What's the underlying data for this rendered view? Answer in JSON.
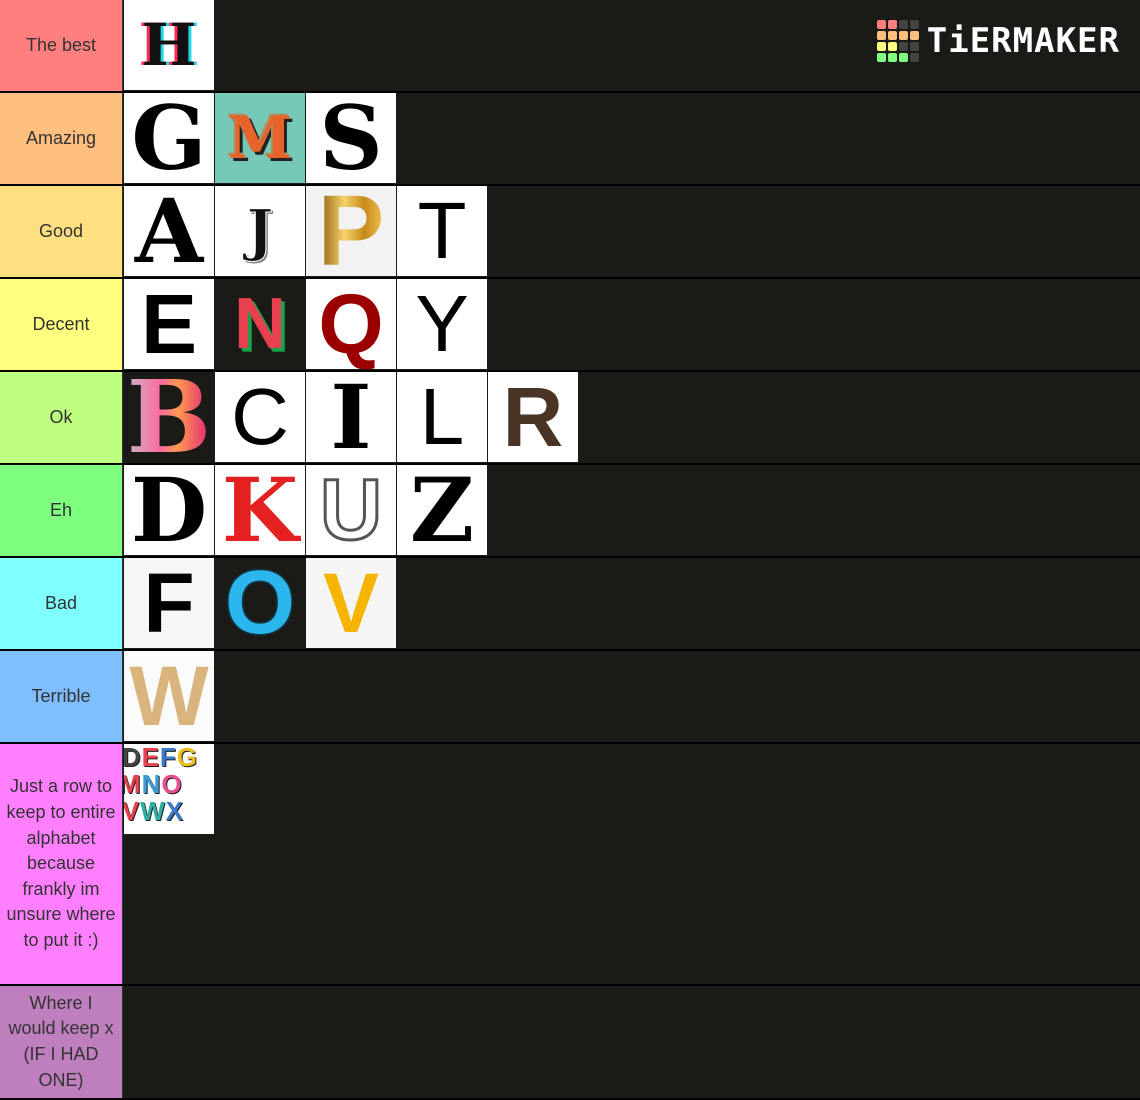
{
  "brand": {
    "name": "TiERMAKER",
    "grid_colors": [
      "#ff7f7f",
      "#ff7f7f",
      "#444444",
      "#444444",
      "#ffbf7f",
      "#ffbf7f",
      "#ffbf7f",
      "#ffbf7f",
      "#ffff7f",
      "#ffff7f",
      "#444444",
      "#444444",
      "#7fff7f",
      "#7fff7f",
      "#7fff7f",
      "#444444"
    ]
  },
  "tiers": [
    {
      "label": "The best",
      "color": "#ff7f7f",
      "items": [
        {
          "letter": "H",
          "style": "glitch",
          "bg": "#ffffff",
          "fg": "#111111"
        }
      ]
    },
    {
      "label": "Amazing",
      "color": "#ffbf7f",
      "items": [
        {
          "letter": "G",
          "style": "serif",
          "bg": "#ffffff",
          "fg": "#000000"
        },
        {
          "letter": "M",
          "style": "3d",
          "bg": "#76c9b6",
          "fg": "#e8632a"
        },
        {
          "letter": "S",
          "style": "serif",
          "bg": "#ffffff",
          "fg": "#000000"
        }
      ]
    },
    {
      "label": "Good",
      "color": "#ffdf7f",
      "items": [
        {
          "letter": "A",
          "style": "serif",
          "bg": "#ffffff",
          "fg": "#000000"
        },
        {
          "letter": "J",
          "style": "varsity",
          "bg": "#ffffff",
          "fg": "#111111"
        },
        {
          "letter": "P",
          "style": "gold",
          "bg": "#f2f2f2",
          "fg": "#d39a1f"
        },
        {
          "letter": "T",
          "style": "thin",
          "bg": "#ffffff",
          "fg": "#000000"
        }
      ]
    },
    {
      "label": "Decent",
      "color": "#ffff7f",
      "items": [
        {
          "letter": "E",
          "style": "sans",
          "bg": "#ffffff",
          "fg": "#000000"
        },
        {
          "letter": "N",
          "style": "watermelon",
          "bg": "#1a1a17",
          "fg": "#e8404f"
        },
        {
          "letter": "Q",
          "style": "sans",
          "bg": "#ffffff",
          "fg": "#9b0000"
        },
        {
          "letter": "Y",
          "style": "thin",
          "bg": "#ffffff",
          "fg": "#000000"
        }
      ]
    },
    {
      "label": "Ok",
      "color": "#bfff7f",
      "items": [
        {
          "letter": "B",
          "style": "neon",
          "bg": "#1a1a17",
          "fg": "#ff8fb0"
        },
        {
          "letter": "C",
          "style": "thin",
          "bg": "#ffffff",
          "fg": "#000000"
        },
        {
          "letter": "I",
          "style": "serif",
          "bg": "#ffffff",
          "fg": "#000000"
        },
        {
          "letter": "L",
          "style": "thin",
          "bg": "#ffffff",
          "fg": "#000000"
        },
        {
          "letter": "R",
          "style": "sans",
          "bg": "#ffffff",
          "fg": "#4a3426"
        }
      ]
    },
    {
      "label": "Eh",
      "color": "#7fff7f",
      "items": [
        {
          "letter": "D",
          "style": "serif",
          "bg": "#ffffff",
          "fg": "#000000"
        },
        {
          "letter": "K",
          "style": "serif",
          "bg": "#ffffff",
          "fg": "#e52020"
        },
        {
          "letter": "U",
          "style": "outline",
          "bg": "#ffffff",
          "fg": "#444444"
        },
        {
          "letter": "Z",
          "style": "serif",
          "bg": "#ffffff",
          "fg": "#000000"
        }
      ]
    },
    {
      "label": "Bad",
      "color": "#7fffff",
      "items": [
        {
          "letter": "F",
          "style": "sans",
          "bg": "#f6f6f6",
          "fg": "#000000"
        },
        {
          "letter": "O",
          "style": "bubble",
          "bg": "#1a1a17",
          "fg": "#2bb6ee"
        },
        {
          "letter": "V",
          "style": "sans",
          "bg": "#f5f5f5",
          "fg": "#f5b400"
        }
      ]
    },
    {
      "label": "Terrible",
      "color": "#7fbfff",
      "items": [
        {
          "letter": "W",
          "style": "sans",
          "bg": "#fbfbfb",
          "fg": "#d9b47c"
        }
      ]
    },
    {
      "label": "Just a row to keep to entire alphabet because frankly im unsure where to put it :)",
      "color": "#ff7fff",
      "items": [
        {
          "letter": "CDEFG LMNO UVWX",
          "style": "alphabet",
          "bg": "#ffffff",
          "fg": "#333333"
        }
      ]
    },
    {
      "label": "Where I would keep x (IF I HAD ONE)",
      "color": "#bf7fbf",
      "items": []
    }
  ]
}
